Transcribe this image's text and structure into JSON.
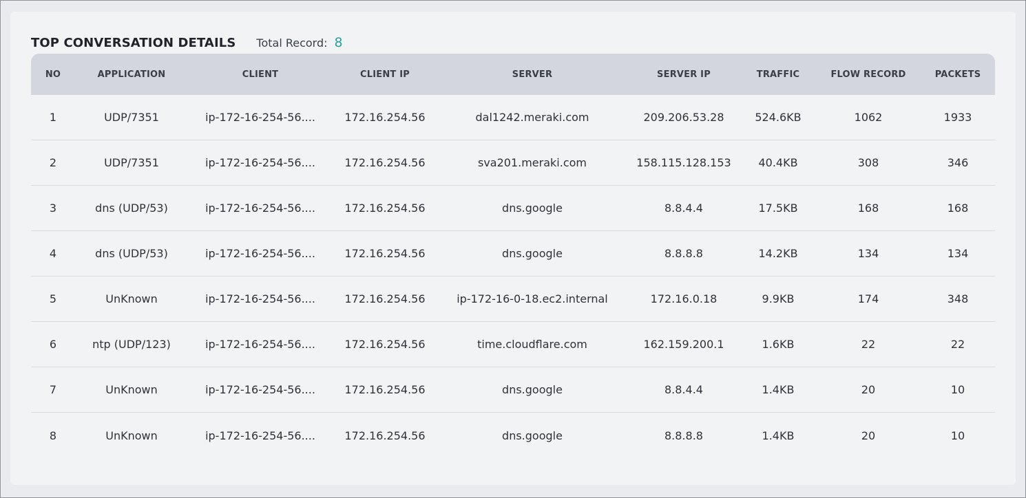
{
  "header": {
    "title": "TOP CONVERSATION DETAILS",
    "total_label": "Total Record:",
    "total_value": "8"
  },
  "colors": {
    "accent": "#2aa39a",
    "header_bg": "#d3d6dc",
    "panel_bg": "#f2f3f5"
  },
  "table": {
    "columns": [
      "NO",
      "APPLICATION",
      "CLIENT",
      "CLIENT IP",
      "SERVER",
      "SERVER IP",
      "TRAFFIC",
      "FLOW RECORD",
      "PACKETS"
    ],
    "rows": [
      [
        "1",
        "UDP/7351",
        "ip-172-16-254-56....",
        "172.16.254.56",
        "dal1242.meraki.com",
        "209.206.53.28",
        "524.6KB",
        "1062",
        "1933"
      ],
      [
        "2",
        "UDP/7351",
        "ip-172-16-254-56....",
        "172.16.254.56",
        "sva201.meraki.com",
        "158.115.128.153",
        "40.4KB",
        "308",
        "346"
      ],
      [
        "3",
        "dns (UDP/53)",
        "ip-172-16-254-56....",
        "172.16.254.56",
        "dns.google",
        "8.8.4.4",
        "17.5KB",
        "168",
        "168"
      ],
      [
        "4",
        "dns (UDP/53)",
        "ip-172-16-254-56....",
        "172.16.254.56",
        "dns.google",
        "8.8.8.8",
        "14.2KB",
        "134",
        "134"
      ],
      [
        "5",
        "UnKnown",
        "ip-172-16-254-56....",
        "172.16.254.56",
        "ip-172-16-0-18.ec2.internal",
        "172.16.0.18",
        "9.9KB",
        "174",
        "348"
      ],
      [
        "6",
        "ntp (UDP/123)",
        "ip-172-16-254-56....",
        "172.16.254.56",
        "time.cloudflare.com",
        "162.159.200.1",
        "1.6KB",
        "22",
        "22"
      ],
      [
        "7",
        "UnKnown",
        "ip-172-16-254-56....",
        "172.16.254.56",
        "dns.google",
        "8.8.4.4",
        "1.4KB",
        "20",
        "10"
      ],
      [
        "8",
        "UnKnown",
        "ip-172-16-254-56....",
        "172.16.254.56",
        "dns.google",
        "8.8.8.8",
        "1.4KB",
        "20",
        "10"
      ]
    ]
  }
}
